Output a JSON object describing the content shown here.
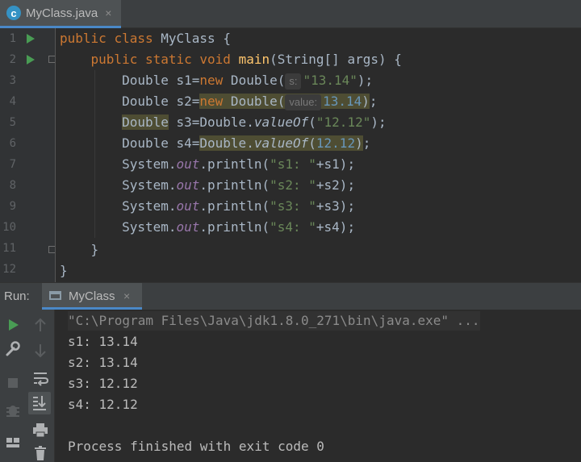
{
  "editor_tab": {
    "label": "MyClass.java",
    "icon": "c",
    "close": "×"
  },
  "line_numbers": [
    "1",
    "2",
    "3",
    "4",
    "5",
    "6",
    "7",
    "8",
    "9",
    "10",
    "11",
    "12"
  ],
  "code": {
    "l1": {
      "kw1": "public",
      "kw2": "class",
      "name": "MyClass {"
    },
    "l2": {
      "kw1": "public",
      "kw2": "static",
      "kw3": "void",
      "fn": "main",
      "rest": "(String[] args) {"
    },
    "l3": {
      "a": "Double s1=",
      "kw": "new",
      "b": " Double(",
      "hint": "s:",
      "str": "\"13.14\"",
      "c": ");"
    },
    "l4": {
      "a": "Double s2=",
      "kw": "new",
      "b": " Double(",
      "hint": "value:",
      "num": "13.14",
      "c": ");"
    },
    "l5": {
      "a": "Double",
      "b": " s3=Double.",
      "m": "valueOf",
      "p": "(",
      "str": "\"12.12\"",
      "c": ");"
    },
    "l6": {
      "a": "Double s4=",
      "b": "Double.",
      "m": "valueOf",
      "p": "(",
      "num": "12.12",
      "c": ");"
    },
    "l7": {
      "a": "System.",
      "f": "out",
      "b": ".println(",
      "str": "\"s1: \"",
      "c": "+s1);"
    },
    "l8": {
      "a": "System.",
      "f": "out",
      "b": ".println(",
      "str": "\"s2: \"",
      "c": "+s2);"
    },
    "l9": {
      "a": "System.",
      "f": "out",
      "b": ".println(",
      "str": "\"s3: \"",
      "c": "+s3);"
    },
    "l10": {
      "a": "System.",
      "f": "out",
      "b": ".println(",
      "str": "\"s4: \"",
      "c": "+s4);"
    },
    "l11": "}",
    "l12": "}"
  },
  "run_panel": {
    "label": "Run:",
    "tab_label": "MyClass",
    "tab_close": "×",
    "console": [
      "\"C:\\Program Files\\Java\\jdk1.8.0_271\\bin\\java.exe\" ...",
      "s1: 13.14",
      "s2: 13.14",
      "s3: 12.12",
      "s4: 12.12",
      "",
      "Process finished with exit code 0"
    ]
  },
  "icons": {
    "run": "play-icon",
    "settings": "wrench-icon",
    "stop": "stop-icon",
    "debug": "bug-icon",
    "layout": "layout-icon",
    "up": "arrow-up-icon",
    "down": "arrow-down-icon",
    "wrap": "soft-wrap-icon",
    "scroll": "scroll-to-end-icon",
    "print": "print-icon",
    "trash": "trash-icon"
  },
  "colors": {
    "keyword": "#cc7832",
    "string": "#6a8759",
    "number": "#6897bb",
    "field": "#9876aa",
    "method": "#ffc66d",
    "accent": "#4a88c7",
    "run_green": "#499c54"
  }
}
